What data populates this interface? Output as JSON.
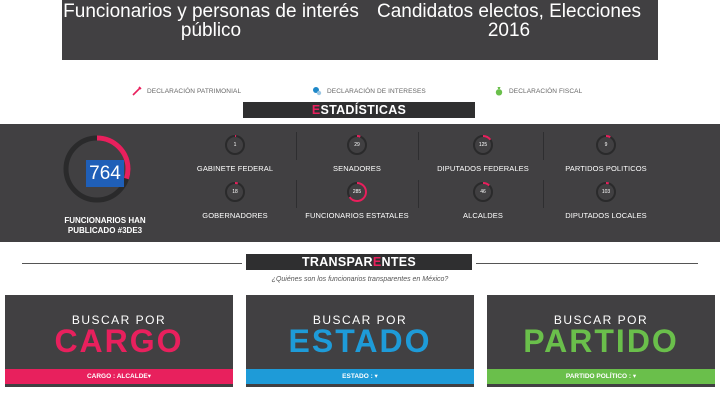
{
  "header": {
    "left_title": "Funcionarios y personas de interés público",
    "right_title": "Candidatos electos, Elecciones 2016"
  },
  "legend": [
    {
      "label": "DECLARACIÓN PATRIMONIAL",
      "icon": "pen-icon",
      "color": "#e8205d"
    },
    {
      "label": "DECLARACIÓN DE INTERESES",
      "icon": "bubble-icon",
      "color": "#1e88c8"
    },
    {
      "label": "DECLARACIÓN FISCAL",
      "icon": "bag-icon",
      "color": "#6abf4b"
    }
  ],
  "stats_section": {
    "title_hl": "E",
    "title_rest": "STADÍSTICAS",
    "total": "764",
    "total_progress": 0.3,
    "total_label": "FUNCIONARIOS HAN PUBLICADO #3DE3",
    "items": [
      {
        "value": "1",
        "label": "GABINETE FEDERAL",
        "progress": 0.02
      },
      {
        "value": "29",
        "label": "SENADORES",
        "progress": 0.06
      },
      {
        "value": "125",
        "label": "DIPUTADOS FEDERALES",
        "progress": 0.15
      },
      {
        "value": "9",
        "label": "PARTIDOS POLITICOS",
        "progress": 0.08
      },
      {
        "value": "18",
        "label": "GOBERNADORES",
        "progress": 0.05
      },
      {
        "value": "285",
        "label": "FUNCIONARIOS ESTATALES",
        "progress": 0.65
      },
      {
        "value": "46",
        "label": "ALCALDES",
        "progress": 0.12
      },
      {
        "value": "103",
        "label": "DIPUTADOS LOCALES",
        "progress": 0.05
      }
    ]
  },
  "transparentes_section": {
    "title_a": "TRANSPAR",
    "title_hl": "E",
    "title_b": "NTES",
    "subtitle": "¿Quiénes son los funcionarios transparentes en México?"
  },
  "cards": [
    {
      "pre": "BUSCAR POR",
      "word": "CARGO",
      "color": "#e8205d",
      "dropdown": "CARGO : ALCALDE▾"
    },
    {
      "pre": "BUSCAR POR",
      "word": "ESTADO",
      "color": "#1e9bd8",
      "dropdown": "ESTADO : ▾"
    },
    {
      "pre": "BUSCAR POR",
      "word": "PARTIDO",
      "color": "#6abf4b",
      "dropdown": "PARTIDO POLÍTICO : ▾"
    }
  ],
  "colors": {
    "ring_track": "#2a2a2b",
    "ring_accent": "#e8205d",
    "total_box": "#1f5fb8"
  }
}
